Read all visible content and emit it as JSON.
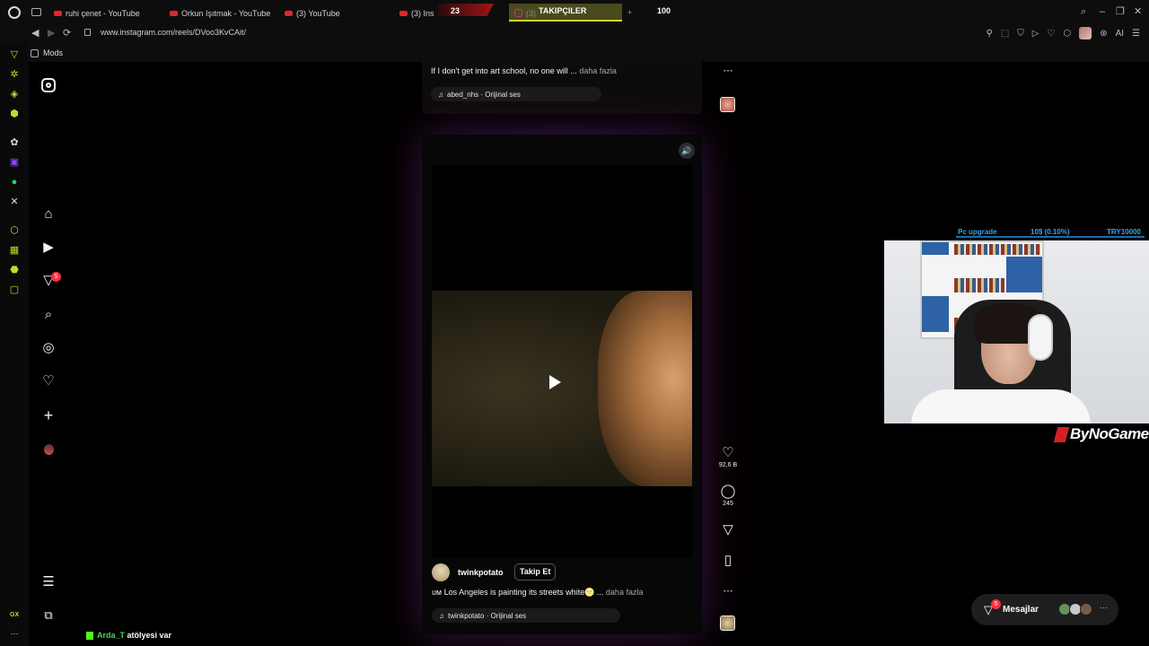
{
  "browser": {
    "tabs": [
      {
        "label": "ruhi çenet - YouTube",
        "kind": "youtube"
      },
      {
        "label": "Orkun Işıtmak - YouTube",
        "kind": "youtube"
      },
      {
        "label": "(3) YouTube",
        "kind": "youtube"
      },
      {
        "label": "(3) Ins",
        "kind": "youtube"
      },
      {
        "label": "(3)",
        "kind": "instagram"
      }
    ],
    "overlay": {
      "counter_left": "23",
      "label": "TAKIPÇILER",
      "counter_right": "100"
    },
    "url": "www.instagram.com/reels/DVoo3KvCAit/",
    "bookmark": "Mods",
    "ai_label": "AI"
  },
  "previous_reel": {
    "caption": "If I don't get into art school, no one will ...",
    "more": "daha fazla",
    "audio": "abed_nhs · Orijinal ses"
  },
  "reel": {
    "username": "twinkpotato",
    "follow_label": "Takip Et",
    "caption": "ᴜᴍ Los Angeles is painting its streets white🌝 ...",
    "more": "daha fazla",
    "audio": "twinkpotato · Orijinal ses",
    "likes": "92,6 B",
    "comments": "245"
  },
  "nav": {
    "notifications_badge": "5"
  },
  "messages": {
    "label": "Mesajlar",
    "badge": "5"
  },
  "stream": {
    "goal_label": "Pc upgrade",
    "goal_progress": "10$ (0.10%)",
    "goal_target": "TRY10000",
    "brand": "ByNoGame",
    "chat_user": "Arda_T",
    "chat_message": "atölyesi var",
    "gx_label": "GX"
  },
  "colors": {
    "accent": "#c8d829",
    "notification": "#ff3040",
    "goal": "#38a5e0"
  }
}
